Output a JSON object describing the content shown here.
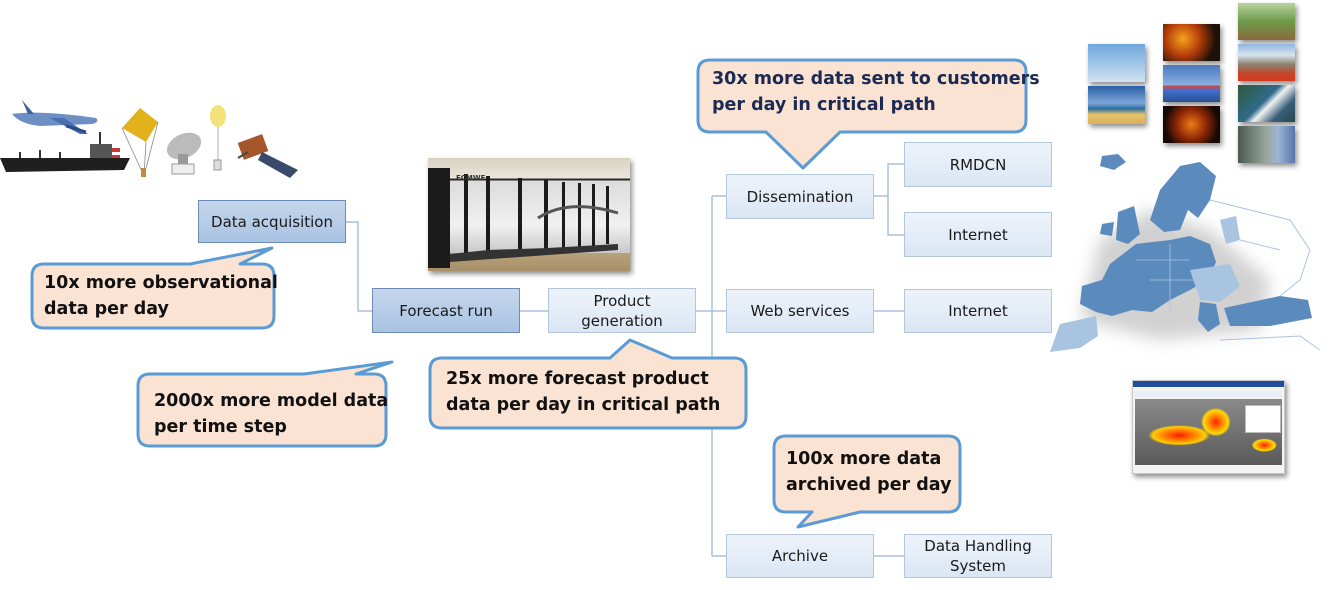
{
  "nodes": {
    "data_acquisition": "Data acquisition",
    "forecast_run": "Forecast run",
    "product_generation": "Product\ngeneration",
    "dissemination": "Dissemination",
    "rmdcn": "RMDCN",
    "internet_dissemination": "Internet",
    "web_services": "Web services",
    "internet_web": "Internet",
    "archive": "Archive",
    "data_handling_system": "Data Handling\nSystem"
  },
  "callouts": {
    "observational": "10x more observational\ndata  per day",
    "model": "2000x more model data\nper time step",
    "forecast_product": "25x more forecast product\ndata per day in critical path",
    "customers": "30x more data sent to customers\nper day in critical path",
    "archived": "100x more data\narchived per day"
  },
  "images": {
    "observing_systems": "observation-platforms-illustration",
    "supercomputer": "supercomputer-photo",
    "applications": "application-photos-collage",
    "europe_map": "europe-member-states-map",
    "web_chart": "web-chart-screenshot"
  },
  "colors": {
    "node_dark": "#b7cde8",
    "node_light": "#e3ebf6",
    "callout_fill": "#fbe3d4",
    "callout_border": "#5b9bd5",
    "connector": "#a8c1de",
    "map_member": "#5b8bbd",
    "map_cooperating": "#a9c4e0"
  }
}
